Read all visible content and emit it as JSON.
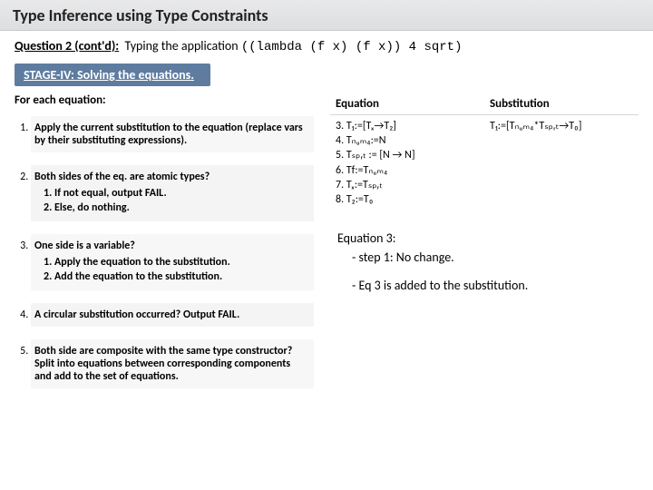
{
  "header": {
    "title": "Type Inference using Type Constraints"
  },
  "question": {
    "label": "Question 2 (cont'd):",
    "prefix": "Typing the application ",
    "code": "((lambda (f x) (f x)) 4 sqrt)"
  },
  "stage": {
    "label": "STAGE-IV: Solving the equations."
  },
  "steps": {
    "heading": "For each equation:",
    "items": [
      {
        "text": "Apply the current substitution to the equation (replace vars by their substituting expressions)."
      },
      {
        "text": "Both sides of the eq. are atomic types?",
        "sub": [
          "If not equal, output FAIL.",
          "Else, do nothing."
        ]
      },
      {
        "text": "One side is a variable?",
        "sub": [
          "Apply the equation to the substitution.",
          "Add the equation to the substitution."
        ]
      },
      {
        "text": "A circular substitution occurred? Output FAIL."
      },
      {
        "text": "Both side are composite with the same type constructor? Split into equations between corresponding components and add to the set of equations."
      }
    ]
  },
  "table": {
    "headers": [
      "Equation",
      "Substitution"
    ],
    "equation": [
      "3. T₁:=[Tₓ→T₂]",
      "4. Tₙᵤₘ₄:=N",
      "5. Tₛₚᵣₜ := [N → N]",
      "6. Tf:=Tₙᵤₘ₄",
      "7. Tₓ:=Tₛₚᵣₜ",
      "8. T₂:=T₀"
    ],
    "substitution": [
      "T₁:=[Tₙᵤₘ₄*Tₛₚᵣₜ→T₀]"
    ]
  },
  "notes": {
    "heading": "Equation 3:",
    "lines": [
      "-   step 1: No change.",
      "-   Eq 3 is added to the substitution."
    ]
  }
}
